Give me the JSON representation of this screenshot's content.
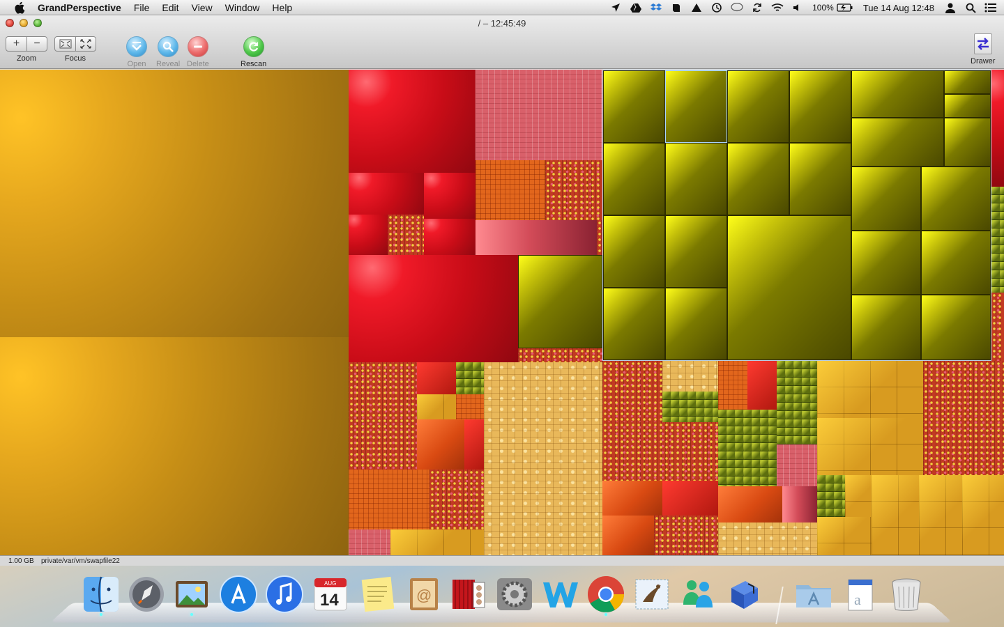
{
  "menubar": {
    "app_name": "GrandPerspective",
    "menus": [
      "File",
      "Edit",
      "View",
      "Window",
      "Help"
    ],
    "battery_percent": "100%",
    "clock": "Tue 14 Aug  12:48"
  },
  "window": {
    "title": "/ – 12:45:49"
  },
  "toolbar": {
    "zoom_label": "Zoom",
    "zoom_in": "+",
    "zoom_out": "−",
    "focus_label": "Focus",
    "open_label": "Open",
    "reveal_label": "Reveal",
    "delete_label": "Delete",
    "rescan_label": "Rescan",
    "drawer_label": "Drawer"
  },
  "status": {
    "size": "1.00 GB",
    "path": "private/var/vm/swapfile22"
  },
  "dock": {
    "apps": [
      "finder-icon",
      "launchpad-icon",
      "iphoto-icon",
      "app-store-icon",
      "itunes-icon",
      "calendar-icon",
      "stickies-icon",
      "address-book-icon",
      "photo-booth-icon",
      "system-preferences-icon",
      "word-icon",
      "chrome-icon",
      "mail-icon",
      "messenger-icon",
      "blue-box-icon",
      "applications-folder-icon",
      "documents-stack-icon",
      "trash-icon"
    ],
    "calendar_month": "AUG",
    "calendar_day": "14"
  },
  "colors": {
    "gold": "#c68e16",
    "red": "#e0101c",
    "olive": "#7b7a00",
    "selection": "#a8d4ff"
  }
}
